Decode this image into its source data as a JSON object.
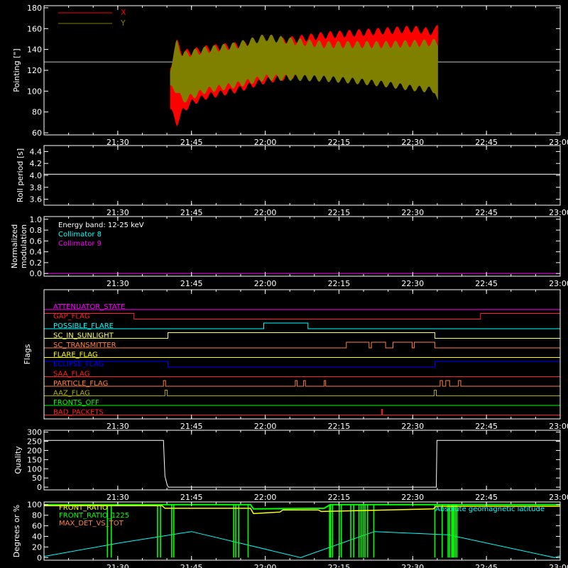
{
  "colors": {
    "background": "#000000",
    "axis": "#ffffff",
    "x_pointing": "#ff0000",
    "y_pointing": "#808000",
    "cyan": "#00ffff",
    "magenta": "#ff00ff",
    "red": "#ff2020",
    "orange": "#ff8040",
    "yellow": "#ffff00",
    "green": "#00ff00",
    "blue": "#0000ff",
    "olive": "#b0b000",
    "pale_yellow": "#ffff60"
  },
  "chart_data": [
    {
      "type": "area",
      "id": "pointing",
      "ylabel": "Pointing [\"]",
      "xlim": [
        21.25,
        23.0
      ],
      "ylim": [
        58,
        182
      ],
      "x_ticks": [
        "21:30",
        "21:45",
        "22:00",
        "22:15",
        "22:30",
        "22:45",
        "23:00"
      ],
      "y_ticks": [
        60,
        80,
        100,
        120,
        140,
        160,
        180
      ],
      "reference_line": 128,
      "legend": [
        {
          "name": "X",
          "color": "#ff0000"
        },
        {
          "name": "Y",
          "color": "#808000"
        }
      ],
      "series": [
        {
          "name": "X",
          "x": [
            21.678,
            21.7,
            21.72,
            21.75,
            21.8,
            21.9,
            22.0,
            22.1,
            22.2,
            22.3,
            22.4,
            22.5,
            22.575,
            22.585
          ],
          "upper": [
            125,
            150,
            140,
            141,
            144,
            147,
            149,
            153,
            157,
            159,
            161,
            163,
            160,
            167
          ],
          "lower": [
            80,
            66,
            78,
            86,
            92,
            98,
            107,
            112,
            115,
            117,
            118,
            119,
            121,
            126
          ]
        },
        {
          "name": "Y",
          "x": [
            21.678,
            21.7,
            21.72,
            21.75,
            21.8,
            21.9,
            22.0,
            22.1,
            22.2,
            22.3,
            22.4,
            22.5,
            22.575,
            22.585
          ],
          "upper": [
            125,
            150,
            138,
            140,
            143,
            147,
            155,
            151,
            148,
            148,
            148,
            149,
            150,
            150
          ],
          "lower": [
            100,
            98,
            88,
            92,
            98,
            103,
            110,
            110,
            109,
            107,
            104,
            100,
            98,
            86
          ]
        }
      ]
    },
    {
      "type": "line",
      "id": "roll",
      "ylabel": "Roll period [s]",
      "xlim": [
        21.25,
        23.0
      ],
      "ylim": [
        3.5,
        4.5
      ],
      "x_ticks": [
        "21:30",
        "21:45",
        "22:00",
        "22:15",
        "22:30",
        "22:45",
        "23:00"
      ],
      "y_ticks": [
        3.6,
        3.8,
        4.0,
        4.2,
        4.4
      ],
      "y_tick_labels": [
        "3.6",
        "3.8",
        "4.0",
        "4.2",
        "4.4"
      ],
      "series": [
        {
          "x": [
            21.25,
            23.0
          ],
          "y": [
            4.02,
            4.02
          ]
        }
      ]
    },
    {
      "type": "line",
      "id": "modulation",
      "ylabel": "Normalized modulation",
      "ylabel_lines": [
        "Normalized",
        "modulation"
      ],
      "xlim": [
        21.25,
        23.0
      ],
      "ylim": [
        -0.05,
        1.05
      ],
      "x_ticks": [
        "21:30",
        "21:45",
        "22:00",
        "22:15",
        "22:30",
        "22:45",
        "23:00"
      ],
      "y_ticks": [
        0.0,
        0.2,
        0.4,
        0.6,
        0.8,
        1.0
      ],
      "y_tick_labels": [
        "0.0",
        "0.2",
        "0.4",
        "0.6",
        "0.8",
        "1.0"
      ],
      "legend": [
        {
          "name": "Energy band: 12-25 keV",
          "color": "#ffffff"
        },
        {
          "name": "Collimator 8",
          "color": "#00ffff"
        },
        {
          "name": "Collimator 9",
          "color": "#ff00ff"
        }
      ],
      "series": [
        {
          "x": [
            21.25,
            23.0
          ],
          "y": [
            0.0,
            0.0
          ]
        }
      ]
    },
    {
      "type": "line",
      "id": "flags",
      "ylabel": "Flags",
      "xlim": [
        21.25,
        23.0
      ],
      "x_ticks": [
        "21:30",
        "21:45",
        "22:00",
        "22:15",
        "22:30",
        "22:45",
        "23:00"
      ],
      "flags": [
        {
          "name": "ATTENUATOR_STATE",
          "color": "#ff00ff",
          "rises": []
        },
        {
          "name": "GAP_FLAG",
          "color": "#ff2020",
          "rises": [
            [
              21.25,
              21.555
            ],
            [
              22.73,
              23.0
            ]
          ]
        },
        {
          "name": "POSSIBLE_FLARE",
          "color": "#00ffff",
          "rises": [
            [
              21.995,
              22.145
            ]
          ]
        },
        {
          "name": "SC_IN_SUNLIGHT",
          "color": "#ffff60",
          "rises": [
            [
              21.67,
              22.575
            ]
          ]
        },
        {
          "name": "SC_TRANSMITTER",
          "color": "#ff8040",
          "rises": [
            [
              22.275,
              22.352
            ],
            [
              22.36,
              22.408
            ],
            [
              22.433,
              22.498
            ],
            [
              22.505,
              22.575
            ]
          ]
        },
        {
          "name": "FLARE_FLAG",
          "color": "#ffff00",
          "rises": []
        },
        {
          "name": "ECLIPSE_FLAG",
          "color": "#0000ff",
          "rises": [
            [
              21.25,
              21.67
            ],
            [
              22.575,
              23.0
            ]
          ]
        },
        {
          "name": "SAA_FLAG",
          "color": "#ff2020",
          "rises": []
        },
        {
          "name": "PARTICLE_FLAG",
          "color": "#ff8040",
          "rises": [
            [
              21.655,
              21.662
            ],
            [
              22.102,
              22.108
            ],
            [
              22.13,
              22.136
            ],
            [
              22.2,
              22.205
            ],
            [
              22.593,
              22.601
            ],
            [
              22.612,
              22.625
            ],
            [
              22.655,
              22.663
            ]
          ]
        },
        {
          "name": "AAZ_FLAG",
          "color": "#b0b000",
          "rises": [
            [
              21.66,
              21.668
            ],
            [
              22.573,
              22.58
            ]
          ]
        },
        {
          "name": "FRONTS_OFF",
          "color": "#00ff00",
          "rises": []
        },
        {
          "name": "BAD_PACKETS",
          "color": "#ff2020",
          "rises": [
            [
              22.394,
              22.397
            ]
          ]
        }
      ]
    },
    {
      "type": "line",
      "id": "quality",
      "ylabel": "Quality",
      "xlim": [
        21.25,
        23.0
      ],
      "ylim": [
        -15,
        310
      ],
      "x_ticks": [
        "21:30",
        "21:45",
        "22:00",
        "22:15",
        "22:30",
        "22:45",
        "23:00"
      ],
      "y_ticks": [
        0,
        50,
        100,
        150,
        200,
        250,
        300
      ],
      "series": [
        {
          "x": [
            21.25,
            21.655,
            21.66,
            21.668,
            21.672,
            22.58,
            22.582,
            23.0
          ],
          "y": [
            255,
            255,
            60,
            10,
            0,
            0,
            255,
            255
          ]
        }
      ]
    },
    {
      "type": "line",
      "id": "ratios",
      "ylabel": "Degrees or %",
      "xlim": [
        21.25,
        23.0
      ],
      "ylim": [
        -5,
        105
      ],
      "x_ticks": [
        "21:30",
        "21:45",
        "22:00",
        "22:15",
        "22:30",
        "22:45",
        "23:00"
      ],
      "y_ticks": [
        0,
        20,
        40,
        60,
        80,
        100
      ],
      "legend": [
        {
          "name": "FRONT_RATIO",
          "color": "#ffff00"
        },
        {
          "name": "FRONT_RATIO_1225",
          "color": "#00ff00"
        },
        {
          "name": "MAX_DET_VS_TOT",
          "color": "#ff8040"
        },
        {
          "name": "Absolute geomagnetic latitude",
          "color": "#00ffff"
        }
      ],
      "series": [
        {
          "name": "FRONT_RATIO",
          "x": [
            21.25,
            21.65,
            21.66,
            21.95,
            21.96,
            22.05,
            22.06,
            22.18,
            22.19,
            22.57,
            22.58,
            23.0
          ],
          "y": [
            98,
            98,
            93,
            93,
            83,
            86,
            90,
            90,
            87,
            92,
            97,
            97
          ]
        },
        {
          "name": "FRONT_RATIO_1225",
          "x": [
            21.25,
            21.95,
            21.96,
            22.2,
            22.22,
            23.0
          ],
          "y": [
            100,
            100,
            92,
            93,
            100,
            100
          ]
        },
        {
          "name": "Absolute geomagnetic latitude",
          "x": [
            21.25,
            21.5,
            21.75,
            22.12,
            22.37,
            22.62,
            22.98,
            23.0
          ],
          "y": [
            2,
            27,
            49,
            0,
            49,
            43,
            0,
            3
          ]
        }
      ],
      "dropouts": [
        21.465,
        21.478,
        21.635,
        21.645,
        21.683,
        21.69,
        21.893,
        21.9,
        21.91,
        21.942,
        22.218,
        22.222,
        22.228,
        22.251,
        22.258,
        22.29,
        22.3,
        22.318,
        22.325,
        22.332,
        22.338,
        22.347,
        22.368,
        22.575,
        22.6,
        22.62,
        22.625,
        22.632,
        22.636,
        22.64,
        22.645,
        22.65
      ]
    }
  ]
}
